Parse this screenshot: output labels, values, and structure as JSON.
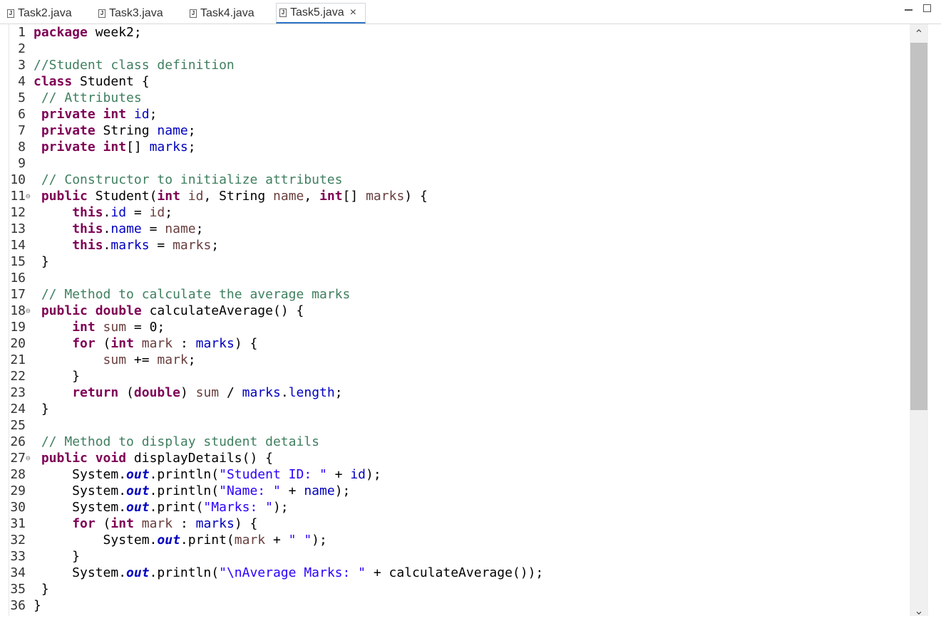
{
  "tabs": [
    {
      "label": "Task2.java",
      "icon": "java-file-icon"
    },
    {
      "label": "Task3.java",
      "icon": "java-file-icon"
    },
    {
      "label": "Task4.java",
      "icon": "java-file-icon"
    },
    {
      "label": "Task5.java",
      "icon": "java-file-icon",
      "active": true
    }
  ],
  "close_glyph": "×",
  "icons": {
    "java_letter": "J",
    "minimize": "minimize-icon",
    "maximize": "maximize-icon",
    "scroll_up_glyph": "⌃",
    "scroll_down_glyph": "⌄"
  },
  "colors": {
    "keyword": "#7f0055",
    "comment": "#3f7f5f",
    "field": "#0000c0",
    "local_variable": "#6a3e3e",
    "string": "#2a00ff",
    "active_tab_underline": "#2f73c8"
  },
  "lines": [
    {
      "n": "1",
      "fold": "",
      "tokens": [
        {
          "t": "package",
          "c": "kw"
        },
        {
          "t": " week2;"
        }
      ]
    },
    {
      "n": "2",
      "fold": "",
      "tokens": []
    },
    {
      "n": "3",
      "fold": "",
      "tokens": [
        {
          "t": "//Student class definition",
          "c": "cm"
        }
      ]
    },
    {
      "n": "4",
      "fold": "",
      "tokens": [
        {
          "t": "class",
          "c": "kw"
        },
        {
          "t": " Student {"
        }
      ]
    },
    {
      "n": "5",
      "fold": "",
      "tokens": [
        {
          "t": " "
        },
        {
          "t": "// Attributes",
          "c": "cm"
        }
      ]
    },
    {
      "n": "6",
      "fold": "",
      "tokens": [
        {
          "t": " "
        },
        {
          "t": "private",
          "c": "kw"
        },
        {
          "t": " "
        },
        {
          "t": "int",
          "c": "kw"
        },
        {
          "t": " "
        },
        {
          "t": "id",
          "c": "fld"
        },
        {
          "t": ";"
        }
      ]
    },
    {
      "n": "7",
      "fold": "",
      "tokens": [
        {
          "t": " "
        },
        {
          "t": "private",
          "c": "kw"
        },
        {
          "t": " String "
        },
        {
          "t": "name",
          "c": "fld"
        },
        {
          "t": ";"
        }
      ]
    },
    {
      "n": "8",
      "fold": "",
      "tokens": [
        {
          "t": " "
        },
        {
          "t": "private",
          "c": "kw"
        },
        {
          "t": " "
        },
        {
          "t": "int",
          "c": "kw"
        },
        {
          "t": "[] "
        },
        {
          "t": "marks",
          "c": "fld"
        },
        {
          "t": ";"
        }
      ]
    },
    {
      "n": "9",
      "fold": "",
      "tokens": []
    },
    {
      "n": "10",
      "fold": "",
      "tokens": [
        {
          "t": " "
        },
        {
          "t": "// Constructor to initialize attributes",
          "c": "cm"
        }
      ]
    },
    {
      "n": "11",
      "fold": "⊖",
      "tokens": [
        {
          "t": " "
        },
        {
          "t": "public",
          "c": "kw"
        },
        {
          "t": " Student("
        },
        {
          "t": "int",
          "c": "kw"
        },
        {
          "t": " "
        },
        {
          "t": "id",
          "c": "var"
        },
        {
          "t": ", String "
        },
        {
          "t": "name",
          "c": "var"
        },
        {
          "t": ", "
        },
        {
          "t": "int",
          "c": "kw"
        },
        {
          "t": "[] "
        },
        {
          "t": "marks",
          "c": "var"
        },
        {
          "t": ") {"
        }
      ]
    },
    {
      "n": "12",
      "fold": "",
      "tokens": [
        {
          "t": "     "
        },
        {
          "t": "this",
          "c": "kw"
        },
        {
          "t": "."
        },
        {
          "t": "id",
          "c": "fld"
        },
        {
          "t": " = "
        },
        {
          "t": "id",
          "c": "var"
        },
        {
          "t": ";"
        }
      ]
    },
    {
      "n": "13",
      "fold": "",
      "tokens": [
        {
          "t": "     "
        },
        {
          "t": "this",
          "c": "kw"
        },
        {
          "t": "."
        },
        {
          "t": "name",
          "c": "fld"
        },
        {
          "t": " = "
        },
        {
          "t": "name",
          "c": "var"
        },
        {
          "t": ";"
        }
      ]
    },
    {
      "n": "14",
      "fold": "",
      "tokens": [
        {
          "t": "     "
        },
        {
          "t": "this",
          "c": "kw"
        },
        {
          "t": "."
        },
        {
          "t": "marks",
          "c": "fld"
        },
        {
          "t": " = "
        },
        {
          "t": "marks",
          "c": "var"
        },
        {
          "t": ";"
        }
      ]
    },
    {
      "n": "15",
      "fold": "",
      "tokens": [
        {
          "t": " }"
        }
      ]
    },
    {
      "n": "16",
      "fold": "",
      "tokens": []
    },
    {
      "n": "17",
      "fold": "",
      "tokens": [
        {
          "t": " "
        },
        {
          "t": "// Method to calculate the average marks",
          "c": "cm"
        }
      ]
    },
    {
      "n": "18",
      "fold": "⊖",
      "tokens": [
        {
          "t": " "
        },
        {
          "t": "public",
          "c": "kw"
        },
        {
          "t": " "
        },
        {
          "t": "double",
          "c": "kw"
        },
        {
          "t": " calculateAverage() {"
        }
      ]
    },
    {
      "n": "19",
      "fold": "",
      "tokens": [
        {
          "t": "     "
        },
        {
          "t": "int",
          "c": "kw"
        },
        {
          "t": " "
        },
        {
          "t": "sum",
          "c": "var"
        },
        {
          "t": " = 0;"
        }
      ]
    },
    {
      "n": "20",
      "fold": "",
      "tokens": [
        {
          "t": "     "
        },
        {
          "t": "for",
          "c": "kw"
        },
        {
          "t": " ("
        },
        {
          "t": "int",
          "c": "kw"
        },
        {
          "t": " "
        },
        {
          "t": "mark",
          "c": "var"
        },
        {
          "t": " : "
        },
        {
          "t": "marks",
          "c": "fld"
        },
        {
          "t": ") {"
        }
      ]
    },
    {
      "n": "21",
      "fold": "",
      "tokens": [
        {
          "t": "         "
        },
        {
          "t": "sum",
          "c": "var"
        },
        {
          "t": " += "
        },
        {
          "t": "mark",
          "c": "var"
        },
        {
          "t": ";"
        }
      ]
    },
    {
      "n": "22",
      "fold": "",
      "tokens": [
        {
          "t": "     }"
        }
      ]
    },
    {
      "n": "23",
      "fold": "",
      "tokens": [
        {
          "t": "     "
        },
        {
          "t": "return",
          "c": "kw"
        },
        {
          "t": " ("
        },
        {
          "t": "double",
          "c": "kw"
        },
        {
          "t": ") "
        },
        {
          "t": "sum",
          "c": "var"
        },
        {
          "t": " / "
        },
        {
          "t": "marks",
          "c": "fld"
        },
        {
          "t": "."
        },
        {
          "t": "length",
          "c": "fld"
        },
        {
          "t": ";"
        }
      ]
    },
    {
      "n": "24",
      "fold": "",
      "tokens": [
        {
          "t": " }"
        }
      ]
    },
    {
      "n": "25",
      "fold": "",
      "tokens": []
    },
    {
      "n": "26",
      "fold": "",
      "tokens": [
        {
          "t": " "
        },
        {
          "t": "// Method to display student details",
          "c": "cm"
        }
      ]
    },
    {
      "n": "27",
      "fold": "⊖",
      "tokens": [
        {
          "t": " "
        },
        {
          "t": "public",
          "c": "kw"
        },
        {
          "t": " "
        },
        {
          "t": "void",
          "c": "kw"
        },
        {
          "t": " displayDetails() {"
        }
      ]
    },
    {
      "n": "28",
      "fold": "",
      "tokens": [
        {
          "t": "     System."
        },
        {
          "t": "out",
          "c": "sfld"
        },
        {
          "t": ".println("
        },
        {
          "t": "\"Student ID: \"",
          "c": "str"
        },
        {
          "t": " + "
        },
        {
          "t": "id",
          "c": "fld"
        },
        {
          "t": ");"
        }
      ]
    },
    {
      "n": "29",
      "fold": "",
      "tokens": [
        {
          "t": "     System."
        },
        {
          "t": "out",
          "c": "sfld"
        },
        {
          "t": ".println("
        },
        {
          "t": "\"Name: \"",
          "c": "str"
        },
        {
          "t": " + "
        },
        {
          "t": "name",
          "c": "fld"
        },
        {
          "t": ");"
        }
      ]
    },
    {
      "n": "30",
      "fold": "",
      "tokens": [
        {
          "t": "     System."
        },
        {
          "t": "out",
          "c": "sfld"
        },
        {
          "t": ".print("
        },
        {
          "t": "\"Marks: \"",
          "c": "str"
        },
        {
          "t": ");"
        }
      ]
    },
    {
      "n": "31",
      "fold": "",
      "tokens": [
        {
          "t": "     "
        },
        {
          "t": "for",
          "c": "kw"
        },
        {
          "t": " ("
        },
        {
          "t": "int",
          "c": "kw"
        },
        {
          "t": " "
        },
        {
          "t": "mark",
          "c": "var"
        },
        {
          "t": " : "
        },
        {
          "t": "marks",
          "c": "fld"
        },
        {
          "t": ") {"
        }
      ]
    },
    {
      "n": "32",
      "fold": "",
      "tokens": [
        {
          "t": "         System."
        },
        {
          "t": "out",
          "c": "sfld"
        },
        {
          "t": ".print("
        },
        {
          "t": "mark",
          "c": "var"
        },
        {
          "t": " + "
        },
        {
          "t": "\" \"",
          "c": "str"
        },
        {
          "t": ");"
        }
      ]
    },
    {
      "n": "33",
      "fold": "",
      "tokens": [
        {
          "t": "     }"
        }
      ]
    },
    {
      "n": "34",
      "fold": "",
      "tokens": [
        {
          "t": "     System."
        },
        {
          "t": "out",
          "c": "sfld"
        },
        {
          "t": ".println("
        },
        {
          "t": "\"\\nAverage Marks: \"",
          "c": "str"
        },
        {
          "t": " + calculateAverage());"
        }
      ]
    },
    {
      "n": "35",
      "fold": "",
      "tokens": [
        {
          "t": " }"
        }
      ]
    },
    {
      "n": "36",
      "fold": "",
      "tokens": [
        {
          "t": "}"
        }
      ]
    }
  ]
}
